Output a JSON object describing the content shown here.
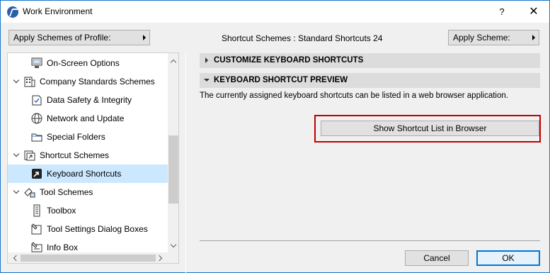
{
  "window": {
    "title": "Work Environment",
    "help_label": "?",
    "close_label": "✕"
  },
  "top": {
    "apply_profile_label": "Apply Schemes of Profile:",
    "shortcut_schemes_label": "Shortcut Schemes :  Standard Shortcuts 24",
    "apply_scheme_label": "Apply Scheme:"
  },
  "tree": {
    "items": [
      {
        "label": "On-Screen Options",
        "icon": "monitor-options-icon",
        "level": 2,
        "expandable": false
      },
      {
        "label": "Company Standards Schemes",
        "icon": "building-schemes-icon",
        "level": 1,
        "expandable": true
      },
      {
        "label": "Data Safety & Integrity",
        "icon": "shield-check-icon",
        "level": 2,
        "expandable": false
      },
      {
        "label": "Network and Update",
        "icon": "globe-icon",
        "level": 2,
        "expandable": false
      },
      {
        "label": "Special Folders",
        "icon": "folder-icon",
        "level": 2,
        "expandable": false
      },
      {
        "label": "Shortcut Schemes",
        "icon": "shortcut-schemes-icon",
        "level": 1,
        "expandable": true
      },
      {
        "label": "Keyboard Shortcuts",
        "icon": "keyboard-shortcut-icon",
        "level": 2,
        "expandable": false,
        "selected": true
      },
      {
        "label": "Tool Schemes",
        "icon": "tool-schemes-icon",
        "level": 1,
        "expandable": true
      },
      {
        "label": "Toolbox",
        "icon": "toolbox-icon",
        "level": 2,
        "expandable": false
      },
      {
        "label": "Tool Settings Dialog Boxes",
        "icon": "tool-settings-icon",
        "level": 2,
        "expandable": false
      },
      {
        "label": "Info Box",
        "icon": "info-box-icon",
        "level": 2,
        "expandable": false
      }
    ]
  },
  "panel": {
    "customize_header": "CUSTOMIZE KEYBOARD SHORTCUTS",
    "preview_header": "KEYBOARD SHORTCUT PREVIEW",
    "description": "The currently assigned keyboard shortcuts can be listed in a web browser application.",
    "show_button": "Show Shortcut List in Browser"
  },
  "footer": {
    "cancel_label": "Cancel",
    "ok_label": "OK"
  },
  "colors": {
    "accent": "#0078d7",
    "highlight_border": "#c00000",
    "selection": "#cce8ff"
  }
}
